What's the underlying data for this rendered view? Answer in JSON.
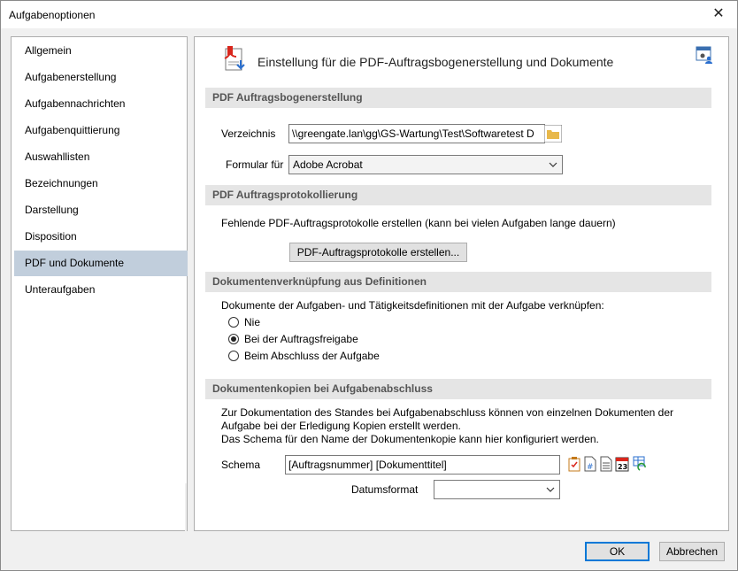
{
  "window": {
    "title": "Aufgabenoptionen",
    "close_glyph": "✕"
  },
  "sidebar": {
    "items": [
      {
        "label": "Allgemein",
        "selected": false
      },
      {
        "label": "Aufgabenerstellung",
        "selected": false
      },
      {
        "label": "Aufgabennachrichten",
        "selected": false
      },
      {
        "label": "Aufgabenquittierung",
        "selected": false
      },
      {
        "label": "Auswahllisten",
        "selected": false
      },
      {
        "label": "Bezeichnungen",
        "selected": false
      },
      {
        "label": "Darstellung",
        "selected": false
      },
      {
        "label": "Disposition",
        "selected": false
      },
      {
        "label": "PDF und Dokumente",
        "selected": true
      },
      {
        "label": "Unteraufgaben",
        "selected": false
      }
    ]
  },
  "header": {
    "title": "Einstellung für die PDF-Auftragsbogenerstellung und Dokumente",
    "icon": "pdf-document-icon",
    "settings_icon": "settings-user-icon"
  },
  "sections": {
    "pdf_creation": {
      "heading": "PDF Auftragsbogenerstellung",
      "directory_label": "Verzeichnis",
      "directory_value": "\\\\greengate.lan\\gg\\GS-Wartung\\Test\\Softwaretest D",
      "form_label": "Formular für",
      "form_value": "Adobe Acrobat"
    },
    "pdf_logging": {
      "heading": "PDF Auftragsprotokollierung",
      "description": "Fehlende PDF-Auftragsprotokolle erstellen (kann bei vielen Aufgaben lange dauern)",
      "button_label": "PDF-Auftragsprotokolle erstellen..."
    },
    "doc_linking": {
      "heading": "Dokumentenverknüpfung aus Definitionen",
      "description": "Dokumente der Aufgaben- und Tätigkeitsdefinitionen mit der Aufgabe verknüpfen:",
      "options": [
        {
          "label": "Nie",
          "checked": false
        },
        {
          "label": "Bei der Auftragsfreigabe",
          "checked": true
        },
        {
          "label": "Beim Abschluss der Aufgabe",
          "checked": false
        }
      ]
    },
    "doc_copies": {
      "heading": "Dokumentenkopien bei Aufgabenabschluss",
      "description_line1": "Zur Dokumentation des Standes bei Aufgabenabschluss können von einzelnen Dokumenten der",
      "description_line2": "Aufgabe bei der Erledigung Kopien erstellt werden.",
      "description_line3": "Das Schema für den Name der Dokumentenkopie kann hier konfiguriert werden.",
      "schema_label": "Schema",
      "schema_value": "[Auftragsnummer] [Dokumenttitel]",
      "date_format_label": "Datumsformat",
      "date_format_value": "",
      "icons": [
        "clipboard-check-icon",
        "hash-document-icon",
        "text-document-icon",
        "calendar-icon",
        "refresh-grid-icon"
      ],
      "calendar_number": "23"
    }
  },
  "footer": {
    "ok_label": "OK",
    "cancel_label": "Abbrechen"
  },
  "colors": {
    "selected_bg": "#c1cedc",
    "section_bg": "#e5e5e5",
    "accent": "#0078d7",
    "pdf_red": "#d9261c",
    "folder_yellow": "#e8b84a"
  }
}
